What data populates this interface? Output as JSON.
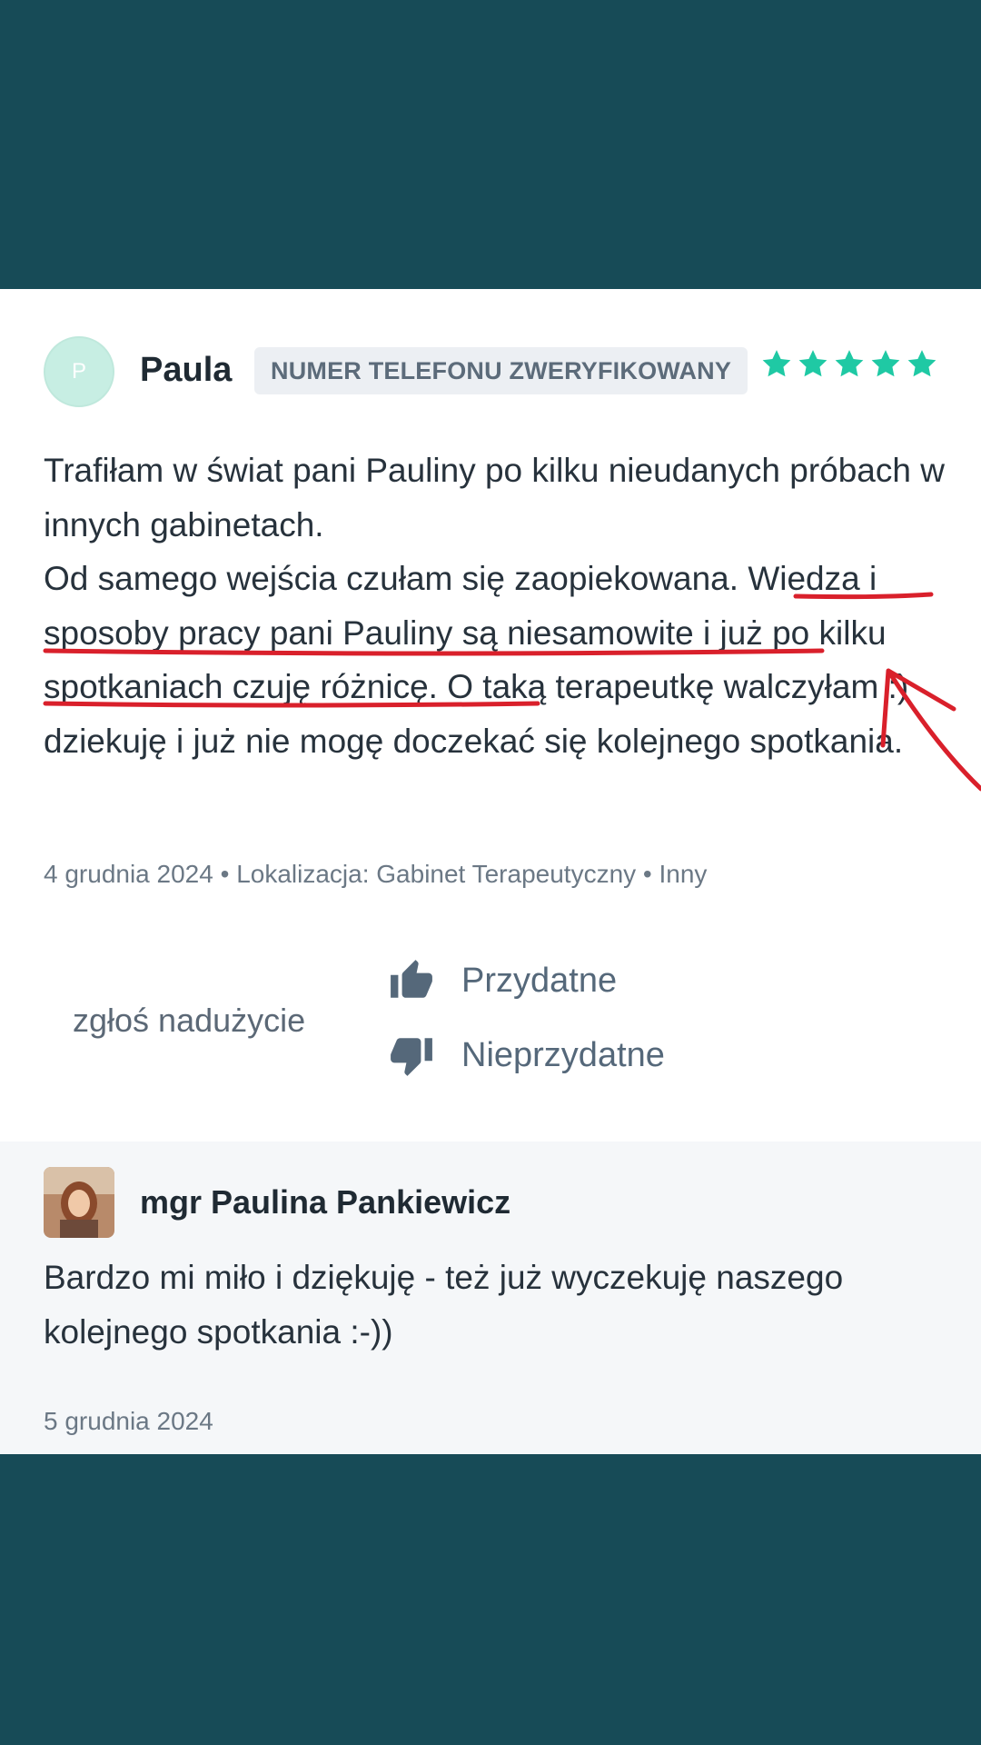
{
  "review": {
    "avatar_letter": "P",
    "author": "Paula",
    "verified_badge": "NUMER TELEFONU ZWERYFIKOWANY",
    "rating": 5,
    "rating_max": 5,
    "star_color": "#1fc9a4",
    "paragraph1": "Trafiłam w świat pani Pauliny po kilku nieudanych próbach w innych gabinetach.",
    "paragraph2": "Od samego wejścia czułam się zaopiekowana. Wiedza i sposoby pracy pani Pauliny są niesamowite i już po kilku spotkaniach czuję różnicę. O taką terapeutkę walczyłam :) dziekuję i już nie mogę doczekać się kolejnego spotkania.",
    "meta": "4 grudnia 2024 • Lokalizacja: Gabinet Terapeutyczny • Inny",
    "report_label": "zgłoś nadużycie",
    "helpful_label": "Przydatne",
    "not_helpful_label": "Nieprzydatne"
  },
  "reply": {
    "author": "mgr Paulina Pankiewicz",
    "text": "Bardzo mi miło i dziękuję - też już wyczekuję naszego kolejnego spotkania :-))",
    "date": "5 grudnia 2024"
  },
  "colors": {
    "background": "#174b57",
    "accent": "#1fc9a4",
    "annotation": "#d9202b"
  }
}
